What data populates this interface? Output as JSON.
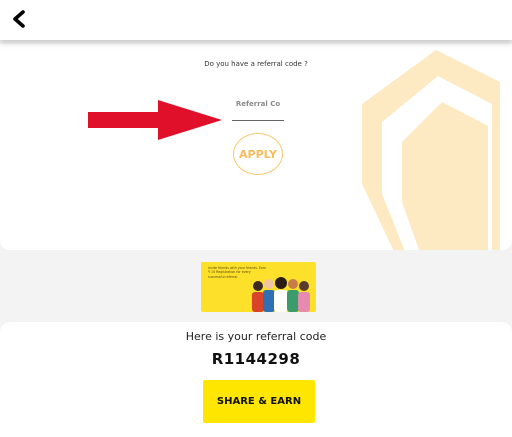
{
  "header": {
    "back_icon": "chevron-left-icon"
  },
  "referral_entry": {
    "question": "Do you have a referral code ?",
    "input_placeholder": "Referral Co",
    "input_value": "",
    "apply_label": "APPLY",
    "arrow_color": "#e0102a",
    "accent_color": "#f8c870"
  },
  "banner": {
    "text": "Invite friends with your friends. Earn ₹ 10 Registration for every successful referral.",
    "background": "#fce02a"
  },
  "my_referral": {
    "heading": "Here is your referral code",
    "code": "R1144298",
    "share_label": "SHARE & EARN",
    "share_color": "#ffe600"
  }
}
